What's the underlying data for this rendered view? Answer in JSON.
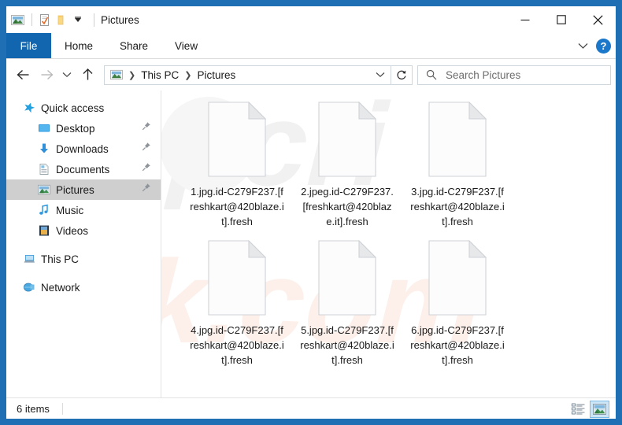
{
  "window": {
    "title": "Pictures",
    "quick_access_icons": [
      "pictures-folder-icon",
      "properties-icon",
      "new-folder-icon",
      "customize-qat-chevron-icon"
    ],
    "controls": {
      "minimize": "minimize-icon",
      "maximize": "maximize-icon",
      "close": "close-icon"
    },
    "frame_color": "#1f6fb5"
  },
  "ribbon": {
    "file_tab": "File",
    "tabs": [
      "Home",
      "Share",
      "View"
    ],
    "collapse_icon": "chevron-down-icon",
    "help_label": "?",
    "file_tab_color": "#1266b0"
  },
  "navigation": {
    "back_icon": "back-arrow-icon",
    "forward_icon": "forward-arrow-icon",
    "recent_icon": "recent-locations-chevron-icon",
    "up_icon": "up-arrow-icon",
    "breadcrumb": [
      "This PC",
      "Pictures"
    ],
    "address_icon": "pictures-folder-icon",
    "dropdown_icon": "chevron-down-icon",
    "refresh_icon": "refresh-icon"
  },
  "search": {
    "placeholder": "Search Pictures",
    "icon": "search-icon"
  },
  "sidebar": {
    "items": [
      {
        "label": "Quick access",
        "icon": "star-icon",
        "indent": 0,
        "pinned": false,
        "selected": false
      },
      {
        "label": "Desktop",
        "icon": "desktop-icon",
        "indent": 1,
        "pinned": true,
        "selected": false
      },
      {
        "label": "Downloads",
        "icon": "downloads-icon",
        "indent": 1,
        "pinned": true,
        "selected": false
      },
      {
        "label": "Documents",
        "icon": "documents-icon",
        "indent": 1,
        "pinned": true,
        "selected": false
      },
      {
        "label": "Pictures",
        "icon": "pictures-icon",
        "indent": 1,
        "pinned": true,
        "selected": true
      },
      {
        "label": "Music",
        "icon": "music-icon",
        "indent": 1,
        "pinned": false,
        "selected": false
      },
      {
        "label": "Videos",
        "icon": "videos-icon",
        "indent": 1,
        "pinned": false,
        "selected": false
      },
      {
        "label": "This PC",
        "icon": "this-pc-icon",
        "indent": 0,
        "pinned": false,
        "selected": false
      },
      {
        "label": "Network",
        "icon": "network-icon",
        "indent": 0,
        "pinned": false,
        "selected": false
      }
    ],
    "selected_bg": "#cfcfcf"
  },
  "files": [
    {
      "name": "1.jpg.id-C279F237.[freshkart@420blaze.it].fresh",
      "icon": "blank-file-icon"
    },
    {
      "name": "2.jpeg.id-C279F237.[freshkart@420blaze.it].fresh",
      "icon": "blank-file-icon"
    },
    {
      "name": "3.jpg.id-C279F237.[freshkart@420blaze.it].fresh",
      "icon": "blank-file-icon"
    },
    {
      "name": "4.jpg.id-C279F237.[freshkart@420blaze.it].fresh",
      "icon": "blank-file-icon"
    },
    {
      "name": "5.jpg.id-C279F237.[freshkart@420blaze.it].fresh",
      "icon": "blank-file-icon"
    },
    {
      "name": "6.jpg.id-C279F237.[freshkart@420blaze.it].fresh",
      "icon": "blank-file-icon"
    }
  ],
  "status": {
    "item_count": "6 items",
    "details_view_icon": "details-view-icon",
    "large-icons_view_icon": "large-icons-view-icon",
    "active_view": "large-icons"
  }
}
